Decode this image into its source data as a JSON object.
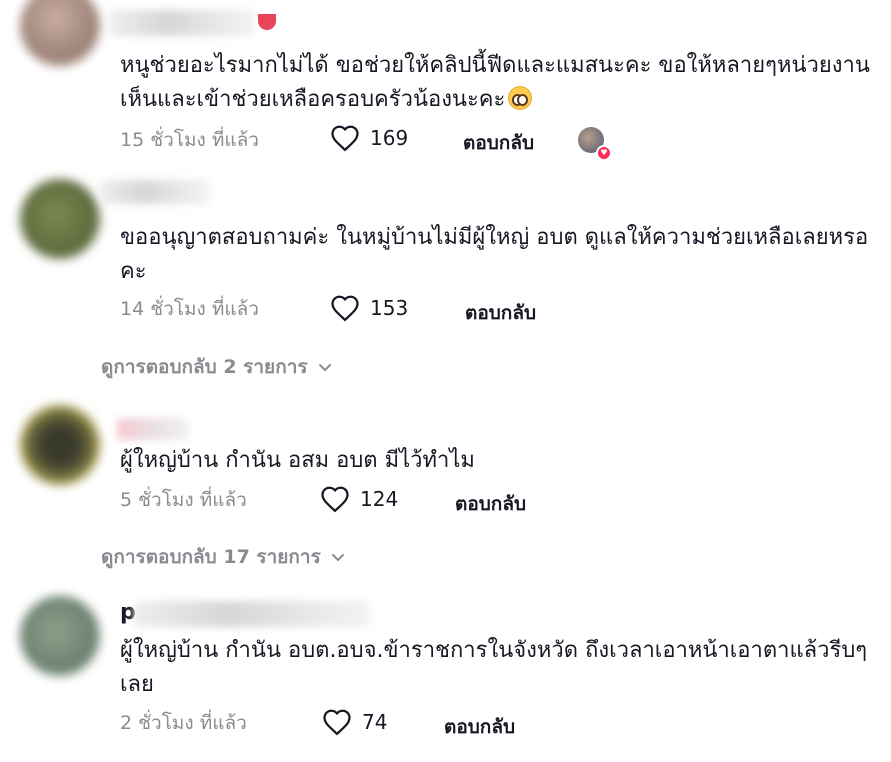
{
  "comments": [
    {
      "text": "หนูช่วยอะไรมากไม่ได้ ขอช่วยให้คลิปนี้ฟีดและแมสนะคะ ขอให้หลายๆหน่วยงานเห็นและเข้าช่วยเหลือครอบครัวน้องนะคะ",
      "emoji": "pleading-face-emoji",
      "time": "15 ชั่วโมง ที่แล้ว",
      "likes": "169",
      "reply_label": "ตอบกลับ",
      "creator_liked": true
    },
    {
      "text": "ขออนุญาตสอบถามค่ะ ในหมู่บ้านไม่มีผู้ใหญ่ อบต ดูแลให้ความช่วยเหลือเลยหรอคะ",
      "time": "14 ชั่วโมง ที่แล้ว",
      "likes": "153",
      "reply_label": "ตอบกลับ",
      "view_replies": "ดูการตอบกลับ 2 รายการ"
    },
    {
      "text": "ผู้ใหญ่บ้าน กำนัน อสม อบต มีไว้ทำไม",
      "time": "5 ชั่วโมง ที่แล้ว",
      "likes": "124",
      "reply_label": "ตอบกลับ",
      "view_replies": "ดูการตอบกลับ 17 รายการ"
    },
    {
      "username_visible": "p",
      "text": "ผู้ใหญ่บ้าน กำนัน อบต.อบจ.ข้าราชการในจังหวัด ถึงเวลาเอาหน้าเอาตาแล้วรีบๆเลย",
      "time": "2 ชั่วโมง ที่แล้ว",
      "likes": "74",
      "reply_label": "ตอบกลับ"
    }
  ],
  "icons": {
    "like": "heart-outline-icon",
    "expand": "chevron-down-icon"
  },
  "colors": {
    "text": "#161823",
    "muted": "#8a8b91",
    "accent": "#fe2c55"
  }
}
